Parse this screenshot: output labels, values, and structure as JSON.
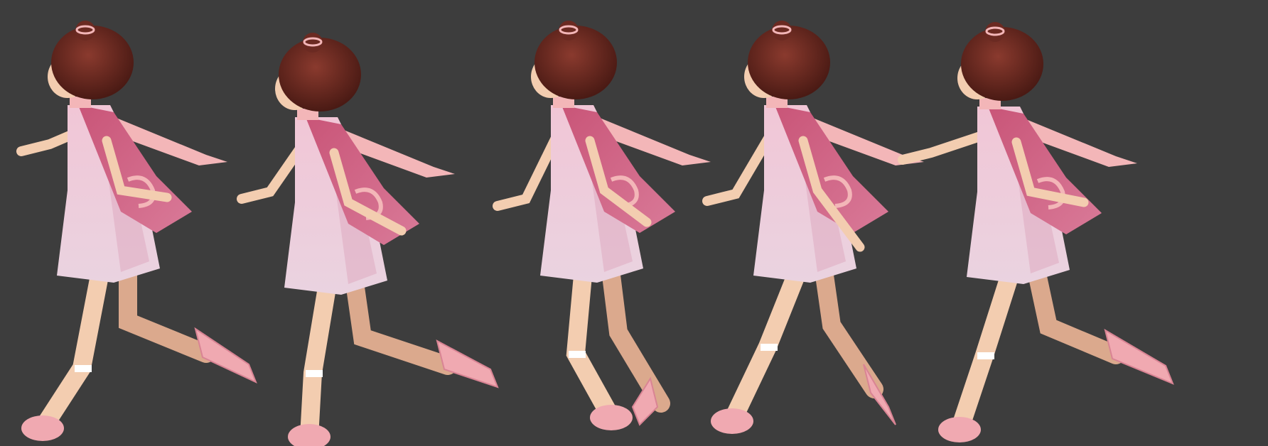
{
  "scene": {
    "background_color": "#3d3d3d",
    "subject": "run-cycle-poses",
    "pose_count": 5,
    "colors": {
      "hair": "#6b2a22",
      "hair_shadow": "#4a1a14",
      "skin": "#f3cdb0",
      "skin_shadow": "#dba98d",
      "dress": "#f1c6d6",
      "dress_shadow": "#dca1bb",
      "scarf": "#c95578",
      "scarf_light": "#f3b6b8",
      "boot": "#f0a9b1",
      "boot_shadow": "#d98494",
      "sock": "#ffffff"
    }
  }
}
